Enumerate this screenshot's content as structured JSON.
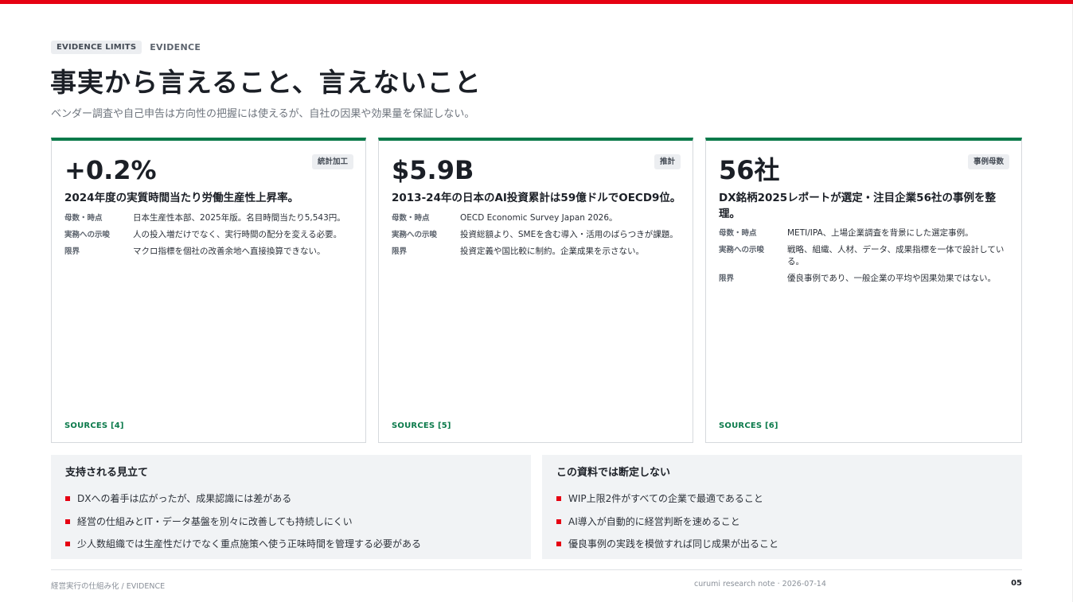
{
  "colors": {
    "accent_red": "#e60012",
    "accent_green": "#0b7a4b"
  },
  "header": {
    "badge": "EVIDENCE LIMITS",
    "section": "EVIDENCE",
    "title": "事実から言えること、言えないこと",
    "subtitle": "ベンダー調査や自己申告は方向性の把握には使えるが、自社の因果や効果量を保証しない。"
  },
  "cards": [
    {
      "value": "+0.2%",
      "tag": "統計加工",
      "headline": "2024年度の実質時間当たり労働生産性上昇率。",
      "rows": [
        {
          "label": "母数・時点",
          "text": "日本生産性本部、2025年版。名目時間当たり5,543円。"
        },
        {
          "label": "実務への示唆",
          "text": "人の投入増だけでなく、実行時間の配分を変える必要。"
        },
        {
          "label": "限界",
          "text": "マクロ指標を個社の改善余地へ直接換算できない。"
        }
      ],
      "sources": "SOURCES [4]"
    },
    {
      "value": "$5.9B",
      "tag": "推計",
      "headline": "2013-24年の日本のAI投資累計は59億ドルでOECD9位。",
      "rows": [
        {
          "label": "母数・時点",
          "text": "OECD Economic Survey Japan 2026。"
        },
        {
          "label": "実務への示唆",
          "text": "投資総額より、SMEを含む導入・活用のばらつきが課題。"
        },
        {
          "label": "限界",
          "text": "投資定義や国比較に制約。企業成果を示さない。"
        }
      ],
      "sources": "SOURCES [5]"
    },
    {
      "value": "56社",
      "tag": "事例母数",
      "headline": "DX銘柄2025レポートが選定・注目企業56社の事例を整理。",
      "rows": [
        {
          "label": "母数・時点",
          "text": "METI/IPA、上場企業調査を背景にした選定事例。"
        },
        {
          "label": "実務への示唆",
          "text": "戦略、組織、人材、データ、成果指標を一体で設計している。"
        },
        {
          "label": "限界",
          "text": "優良事例であり、一般企業の平均や因果効果ではない。"
        }
      ],
      "sources": "SOURCES [6]"
    }
  ],
  "supported": {
    "title": "支持される見立て",
    "items": [
      "DXへの着手は広がったが、成果認識には差がある",
      "経営の仕組みとIT・データ基盤を別々に改善しても持続しにくい",
      "少人数組織では生産性だけでなく重点施策へ使う正味時間を管理する必要がある"
    ]
  },
  "not_asserted": {
    "title": "この資料では断定しない",
    "items": [
      "WIP上限2件がすべての企業で最適であること",
      "AI導入が自動的に経営判断を速めること",
      "優良事例の実践を模倣すれば同じ成果が出ること"
    ]
  },
  "footer": {
    "left": "経営実行の仕組み化 / EVIDENCE",
    "middle": "curumi research note · 2026-07-14",
    "page": "05"
  }
}
